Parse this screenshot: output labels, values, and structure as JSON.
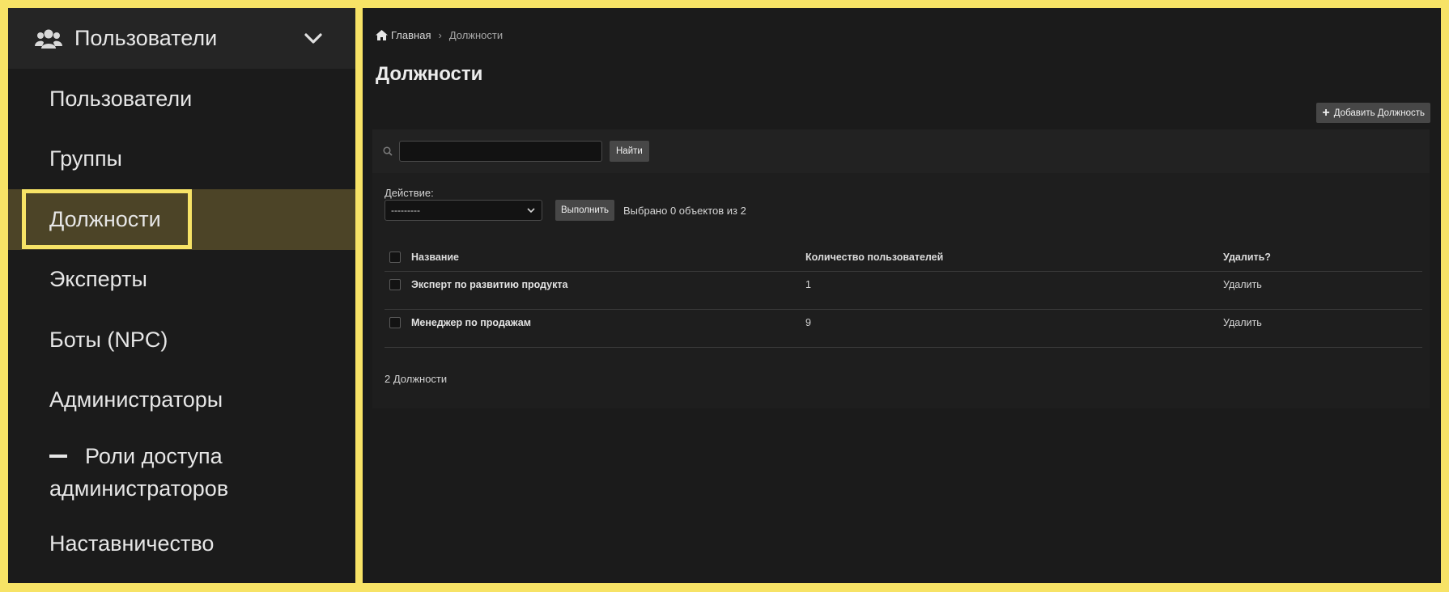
{
  "sidebar": {
    "header": {
      "title": "Пользователи",
      "icon": "users-icon",
      "toggle_icon": "chevron-down-icon"
    },
    "items": [
      {
        "label": "Пользователи"
      },
      {
        "label": "Группы"
      },
      {
        "label": "Должности",
        "active": true
      },
      {
        "label": "Эксперты"
      },
      {
        "label": "Боты (NPC)"
      },
      {
        "label": "Администраторы"
      },
      {
        "label_line1": "Роли доступа",
        "label_line2": "администраторов",
        "prefix_icon": "dash-icon"
      },
      {
        "label": "Наставничество"
      }
    ]
  },
  "breadcrumb": {
    "home": "Главная",
    "separator": "›",
    "current": "Должности"
  },
  "page": {
    "title": "Должности",
    "add_button": "Добавить Должность"
  },
  "search": {
    "value": "",
    "button": "Найти"
  },
  "actions": {
    "label": "Действие:",
    "select_value": "---------",
    "run_button": "Выполнить",
    "selected_text": "Выбрано 0 объектов из 2"
  },
  "table": {
    "columns": [
      "Название",
      "Количество пользователей",
      "Удалить?"
    ],
    "rows": [
      {
        "name": "Эксперт по развитию продукта",
        "count": "1",
        "delete": "Удалить"
      },
      {
        "name": "Менеджер по продажам",
        "count": "9",
        "delete": "Удалить"
      }
    ]
  },
  "footer": {
    "count_text": "2 Должности"
  },
  "colors": {
    "accent": "#f7e366",
    "active_bg": "#4c4427",
    "background": "#1b1b1b"
  }
}
